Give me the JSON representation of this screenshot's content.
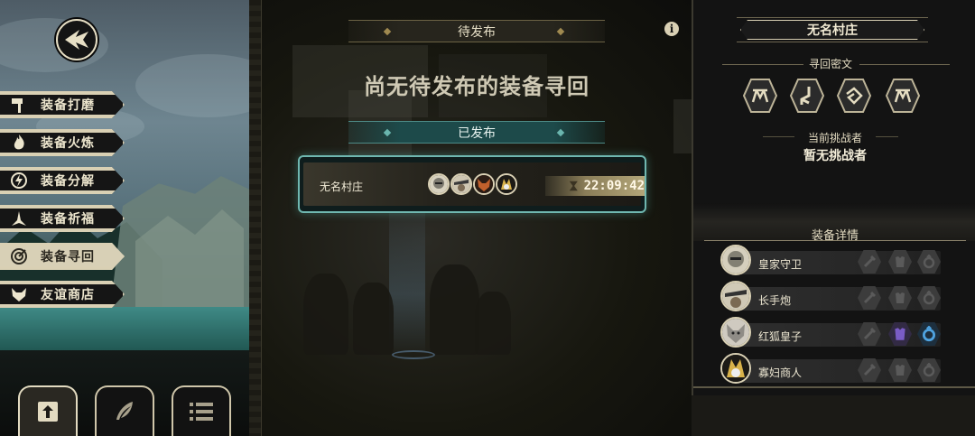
{
  "left_menu": {
    "items": [
      {
        "label": "装备打磨",
        "icon": "hammer-icon"
      },
      {
        "label": "装备火炼",
        "icon": "flame-icon"
      },
      {
        "label": "装备分解",
        "icon": "disassemble-icon"
      },
      {
        "label": "装备祈福",
        "icon": "bless-icon"
      },
      {
        "label": "装备寻回",
        "icon": "retrieve-icon",
        "active": true
      },
      {
        "label": "友谊商店",
        "icon": "fox-icon"
      }
    ],
    "bottom_tabs": [
      {
        "icon": "upload-icon",
        "active": true
      },
      {
        "icon": "feather-icon",
        "active": false
      },
      {
        "icon": "list-icon",
        "active": false
      }
    ]
  },
  "middle": {
    "pending_label": "待发布",
    "empty_pending_text": "尚无待发布的装备寻回",
    "published_label": "已发布",
    "published_quest": {
      "name": "无名村庄",
      "timer": "22:09:42",
      "avatars": [
        "knight-avatar",
        "gunner-avatar",
        "fox-prince-avatar",
        "widow-merchant-avatar"
      ]
    }
  },
  "right": {
    "title": "无名村庄",
    "cipher_heading": "寻回密文",
    "cipher_icons": [
      "cipher-rune-1-icon",
      "cipher-rune-2-icon",
      "cipher-rune-3-icon",
      "cipher-rune-4-icon"
    ],
    "challenger_heading": "当前挑战者",
    "challenger_value": "暂无挑战者",
    "detail_heading": "装备详情",
    "heroes": [
      {
        "name": "皇家守卫",
        "highlight": false
      },
      {
        "name": "长手炮",
        "highlight": false
      },
      {
        "name": "红狐皇子",
        "highlight": true
      },
      {
        "name": "寡妇商人",
        "highlight": false
      }
    ]
  },
  "colors": {
    "accent_cream": "#d9d0b4",
    "teal": "#6fb7b0",
    "armor_purple": "#7a5cc6",
    "ring_blue": "#4fa3e0"
  }
}
